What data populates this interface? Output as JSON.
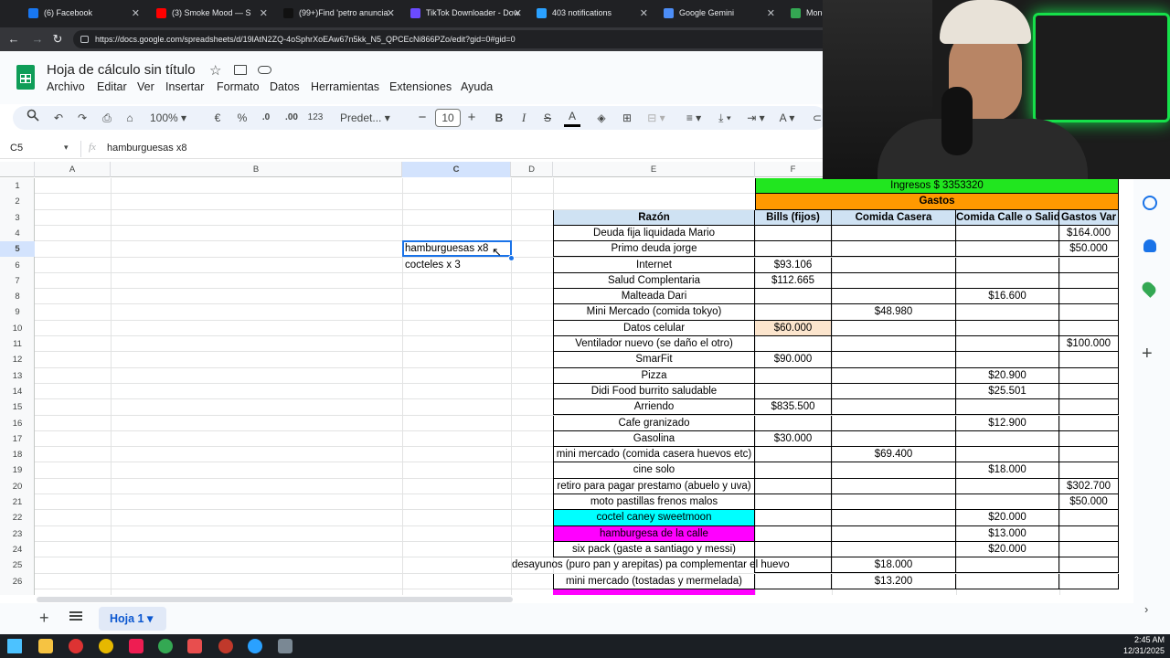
{
  "browser": {
    "tabs": [
      {
        "label": "(6) Facebook",
        "color": "#1877f2"
      },
      {
        "label": "(3) Smoke Mood — S",
        "color": "#ff0000"
      },
      {
        "label": "(99+)Find 'petro anuncia",
        "color": "#111111"
      },
      {
        "label": "TikTok Downloader - Dow",
        "color": "#6b4bff"
      },
      {
        "label": "403 notifications",
        "color": "#2aa1ff"
      },
      {
        "label": "Google Gemini",
        "color": "#4c8df6"
      },
      {
        "label": "Monet",
        "color": "#34a853"
      }
    ],
    "url": "https://docs.google.com/spreadsheets/d/19lAtN2ZQ-4oSphrXoEAw67n5kk_N5_QPCEcNi866PZo/edit?gid=0#gid=0"
  },
  "doc": {
    "title": "Hoja de cálculo sin título",
    "menus": [
      "Archivo",
      "Editar",
      "Ver",
      "Insertar",
      "Formato",
      "Datos",
      "Herramientas",
      "Extensiones",
      "Ayuda"
    ]
  },
  "toolbar": {
    "zoom": "100%",
    "currency": "€",
    "percent": "%",
    "dec_less": ".0",
    "dec_more": ".00",
    "format_num": "123",
    "font": "Predet...",
    "font_size": "10",
    "bold": "B",
    "italic": "I",
    "font_color": "A"
  },
  "formula_bar": {
    "cell_ref": "C5",
    "fx": "fx",
    "content": "hamburguesas x8"
  },
  "columns": [
    "A",
    "B",
    "C",
    "D",
    "E",
    "F"
  ],
  "rows": [
    "1",
    "2",
    "3",
    "4",
    "5",
    "6",
    "7",
    "8",
    "9",
    "10",
    "11",
    "12",
    "13",
    "14",
    "15",
    "16",
    "17",
    "18",
    "19",
    "20",
    "21",
    "22",
    "23",
    "24",
    "25",
    "26"
  ],
  "notes": {
    "c5": "hamburguesas x8",
    "c6": "cocteles x 3"
  },
  "ledger": {
    "ingresos": "Ingresos $ 3353320",
    "gastos": "Gastos",
    "headers": [
      "Razón",
      "Bills (fijos)",
      "Comida Casera",
      "Comida Calle o Salida",
      "Gastos Var"
    ],
    "rows": [
      {
        "razon": "Deuda fija liquidada Mario",
        "bills": "",
        "casera": "",
        "calle": "",
        "var": "$164.000"
      },
      {
        "razon": "Primo deuda jorge",
        "bills": "",
        "casera": "",
        "calle": "",
        "var": "$50.000"
      },
      {
        "razon": "Internet",
        "bills": "$93.106",
        "casera": "",
        "calle": "",
        "var": ""
      },
      {
        "razon": "Salud Complentaria",
        "bills": "$112.665",
        "casera": "",
        "calle": "",
        "var": ""
      },
      {
        "razon": "Malteada Dari",
        "bills": "",
        "casera": "",
        "calle": "$16.600",
        "var": ""
      },
      {
        "razon": "Mini Mercado (comida tokyo)",
        "bills": "",
        "casera": "$48.980",
        "calle": "",
        "var": ""
      },
      {
        "razon": "Datos celular",
        "bills": "$60.000",
        "casera": "",
        "calle": "",
        "var": ""
      },
      {
        "razon": "Ventilador nuevo (se daño el otro)",
        "bills": "",
        "casera": "",
        "calle": "",
        "var": "$100.000"
      },
      {
        "razon": "SmarFit",
        "bills": "$90.000",
        "casera": "",
        "calle": "",
        "var": ""
      },
      {
        "razon": "Pizza",
        "bills": "",
        "casera": "",
        "calle": "$20.900",
        "var": ""
      },
      {
        "razon": "Didi Food burrito saludable",
        "bills": "",
        "casera": "",
        "calle": "$25.501",
        "var": ""
      },
      {
        "razon": "Arriendo",
        "bills": "$835.500",
        "casera": "",
        "calle": "",
        "var": ""
      },
      {
        "razon": "Cafe granizado",
        "bills": "",
        "casera": "",
        "calle": "$12.900",
        "var": ""
      },
      {
        "razon": "Gasolina",
        "bills": "$30.000",
        "casera": "",
        "calle": "",
        "var": ""
      },
      {
        "razon": "mini mercado (comida casera huevos etc)",
        "bills": "",
        "casera": "$69.400",
        "calle": "",
        "var": ""
      },
      {
        "razon": "cine solo",
        "bills": "",
        "casera": "",
        "calle": "$18.000",
        "var": ""
      },
      {
        "razon": "retiro para pagar prestamo (abuelo y uva)",
        "bills": "",
        "casera": "",
        "calle": "",
        "var": "$302.700"
      },
      {
        "razon": "moto pastillas frenos malos",
        "bills": "",
        "casera": "",
        "calle": "",
        "var": "$50.000"
      },
      {
        "razon": "coctel caney sweetmoon",
        "bills": "",
        "casera": "",
        "calle": "$20.000",
        "var": ""
      },
      {
        "razon": "hamburgesa de la calle",
        "bills": "",
        "casera": "",
        "calle": "$13.000",
        "var": ""
      },
      {
        "razon": "six pack (gaste a santiago y messi)",
        "bills": "",
        "casera": "",
        "calle": "$20.000",
        "var": ""
      },
      {
        "razon": "desayunos (puro pan y arepitas) pa complementar el huevo",
        "bills": "",
        "casera": "$18.000",
        "calle": "",
        "var": ""
      },
      {
        "razon": "mini mercado (tostadas y mermelada)",
        "bills": "",
        "casera": "$13.200",
        "calle": "",
        "var": ""
      }
    ]
  },
  "sheet_tab": "Hoja 1",
  "clock": {
    "time": "2:45 AM",
    "date": "12/31/2025"
  },
  "colors": {
    "green": "#21e61f",
    "orange": "#ff9900",
    "header_blue": "#cfe2f3",
    "cyan": "#00ffff",
    "magenta": "#ff00ff",
    "peach": "#fce5cd",
    "accent": "#0b57d0"
  }
}
